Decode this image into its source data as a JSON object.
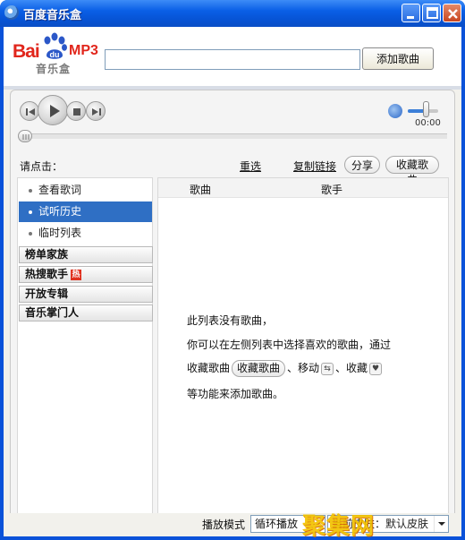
{
  "window": {
    "title": "百度音乐盒",
    "icons": [
      "app-icon",
      "minimize-icon",
      "maximize-icon",
      "close-icon"
    ]
  },
  "header": {
    "logo": {
      "brand": "Bai",
      "du": "du",
      "suffix": "MP3",
      "subtitle": "音乐盒"
    },
    "search": {
      "value": "",
      "placeholder": ""
    },
    "add_song_label": "添加歌曲"
  },
  "player": {
    "controls": [
      "prev-icon",
      "play-icon",
      "stop-icon",
      "next-icon"
    ],
    "time": "00:00",
    "volume_level": 0.55,
    "progress": 0
  },
  "toolbar": {
    "hint": "请点击：",
    "reselect_label": "重选",
    "copy_link_label": "复制链接",
    "share_label": "分享",
    "collect_label": "收藏歌曲"
  },
  "sidebar": {
    "items": [
      {
        "label": "查看歌词",
        "active": false
      },
      {
        "label": "试听历史",
        "active": true
      },
      {
        "label": "临时列表",
        "active": false
      }
    ],
    "categories": [
      {
        "label": "榜单家族"
      },
      {
        "label": "热搜歌手",
        "badge": "热"
      },
      {
        "label": "开放专辑"
      },
      {
        "label": "音乐掌门人"
      }
    ]
  },
  "table": {
    "columns": [
      "歌曲",
      "歌手"
    ],
    "empty_lines": [
      "此列表没有歌曲，",
      "你可以在左侧列表中选择喜欢的歌曲，通过",
      "收藏歌曲",
      "等功能来添加歌曲。"
    ],
    "empty_collect_button": "收藏歌曲",
    "empty_move_label": "、移动",
    "empty_collect_label": "、收藏"
  },
  "bottom": {
    "mode_label": "播放模式",
    "mode_value": "循环播放",
    "skin_value": "当前皮肤：默认皮肤",
    "watermark": "聚集网"
  },
  "colors": {
    "titlebar": "#0a5fe6",
    "active_item": "#2f6fc4",
    "hot_badge": "#e0301e",
    "brand_red": "#e1261c"
  }
}
